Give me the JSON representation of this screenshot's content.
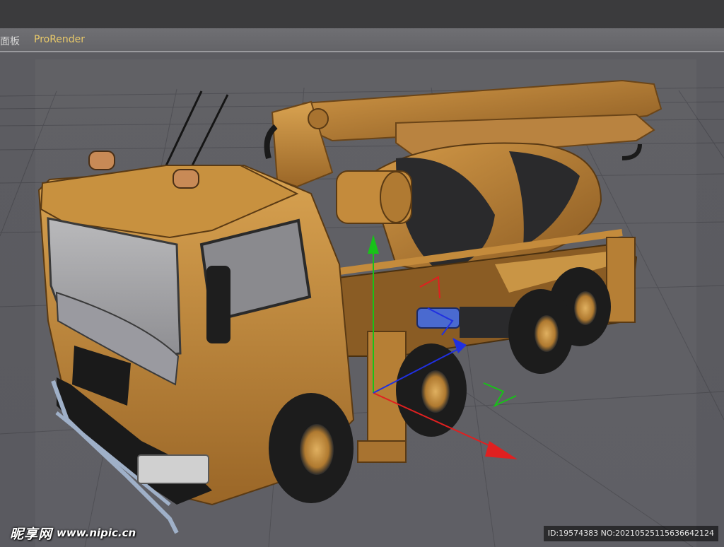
{
  "menubar": {
    "items": [
      {
        "label": "面板"
      },
      {
        "label": "ProRender"
      }
    ]
  },
  "viewport": {
    "subject": "concrete-pump-mixer-truck-3d-model",
    "axis_colors": {
      "x": "#e02020",
      "y": "#18c218",
      "z": "#2030e0"
    },
    "colors": {
      "background": "#56565b",
      "grid": "#4a4a4f",
      "truck_body": "#c0893a",
      "truck_shadow": "#7a4f1c",
      "tires": "#1c1c1c"
    }
  },
  "watermark": {
    "brand": "昵享网",
    "url": "www.nipic.cn",
    "id_text": "ID:19574383 NO:20210525115636642124"
  }
}
